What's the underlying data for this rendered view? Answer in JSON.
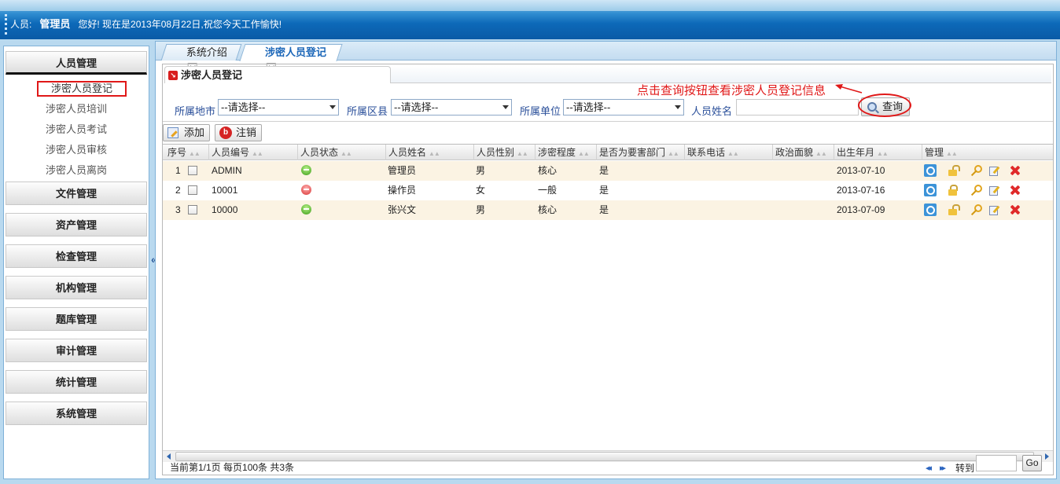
{
  "header": {
    "user_label": "人员:",
    "user_name": "管理员",
    "welcome": "您好!   现在是2013年08月22日,祝您今天工作愉快!"
  },
  "sidebar": {
    "collapse_glyph": "«",
    "menus": [
      {
        "label": "人员管理",
        "expanded": true,
        "items": [
          "涉密人员登记",
          "涉密人员培训",
          "涉密人员考试",
          "涉密人员审核",
          "涉密人员离岗"
        ],
        "selected_item": "涉密人员登记"
      },
      {
        "label": "文件管理"
      },
      {
        "label": "资产管理"
      },
      {
        "label": "检查管理"
      },
      {
        "label": "机构管理"
      },
      {
        "label": "题库管理"
      },
      {
        "label": "审计管理"
      },
      {
        "label": "统计管理"
      },
      {
        "label": "系统管理"
      }
    ]
  },
  "tabs": [
    {
      "label": "系统介绍",
      "active": false
    },
    {
      "label": "涉密人员登记",
      "active": true
    }
  ],
  "panel": {
    "title": "涉密人员登记",
    "annotation": "点击查询按钮查看涉密人员登记信息"
  },
  "filters": {
    "city_label": "所属地市",
    "city_value": "--请选择--",
    "county_label": "所属区县",
    "county_value": "--请选择--",
    "unit_label": "所属单位",
    "unit_value": "--请选择--",
    "name_label": "人员姓名",
    "name_value": "",
    "query_button": "查询"
  },
  "toolbar": {
    "add_label": "添加",
    "cancel_label": "注销"
  },
  "table": {
    "columns": [
      "序号",
      "人员编号",
      "人员状态",
      "人员姓名",
      "人员性别",
      "涉密程度",
      "是否为要害部门",
      "联系电话",
      "政治面貌",
      "出生年月",
      "管理"
    ],
    "rows": [
      {
        "index": "1",
        "code": "ADMIN",
        "status": "green",
        "name": "管理员",
        "gender": "男",
        "level": "核心",
        "key_dept": "是",
        "phone": "",
        "political": "",
        "birth": "2013-07-10",
        "lock": "open"
      },
      {
        "index": "2",
        "code": "10001",
        "status": "red",
        "name": "操作员",
        "gender": "女",
        "level": "一般",
        "key_dept": "是",
        "phone": "",
        "political": "",
        "birth": "2013-07-16",
        "lock": "closed"
      },
      {
        "index": "3",
        "code": "10000",
        "status": "green",
        "name": "张兴文",
        "gender": "男",
        "level": "核心",
        "key_dept": "是",
        "phone": "",
        "political": "",
        "birth": "2013-07-09",
        "lock": "open"
      }
    ]
  },
  "pager": {
    "info": "当前第1/1页  每页100条  共3条",
    "first_glyph": "◂◂",
    "last_glyph": "▸▸",
    "goto_label": "转到",
    "goto_value": "",
    "go_button": "Go"
  }
}
